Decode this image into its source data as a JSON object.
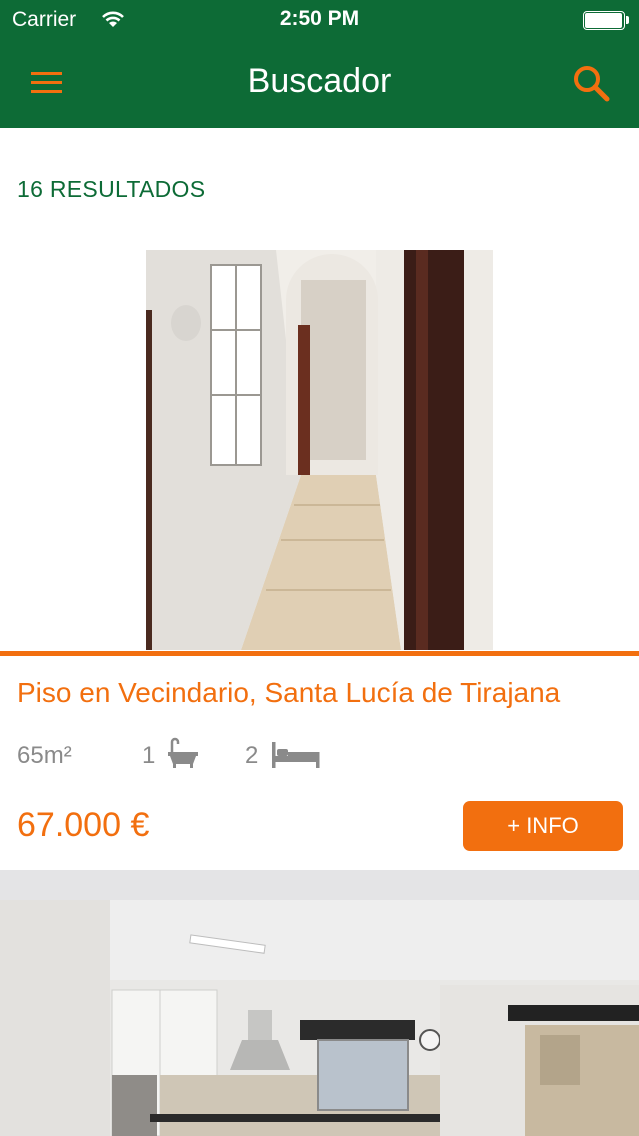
{
  "status_bar": {
    "carrier": "Carrier",
    "time": "2:50 PM"
  },
  "nav": {
    "title": "Buscador",
    "menu_icon": "hamburger-menu-icon",
    "search_icon": "search-icon"
  },
  "results": {
    "count_label": "16 RESULTADOS"
  },
  "listings": [
    {
      "title": "Piso en Vecindario, Santa Lucía de Tirajana",
      "area": "65m²",
      "bathrooms": "1",
      "bedrooms": "2",
      "price": "67.000 €",
      "info_button": "+ INFO"
    }
  ],
  "colors": {
    "brand_green": "#0d6b36",
    "accent_orange": "#f26f0f",
    "muted_text": "#8a8a8a",
    "separator": "#e4e4e6"
  }
}
